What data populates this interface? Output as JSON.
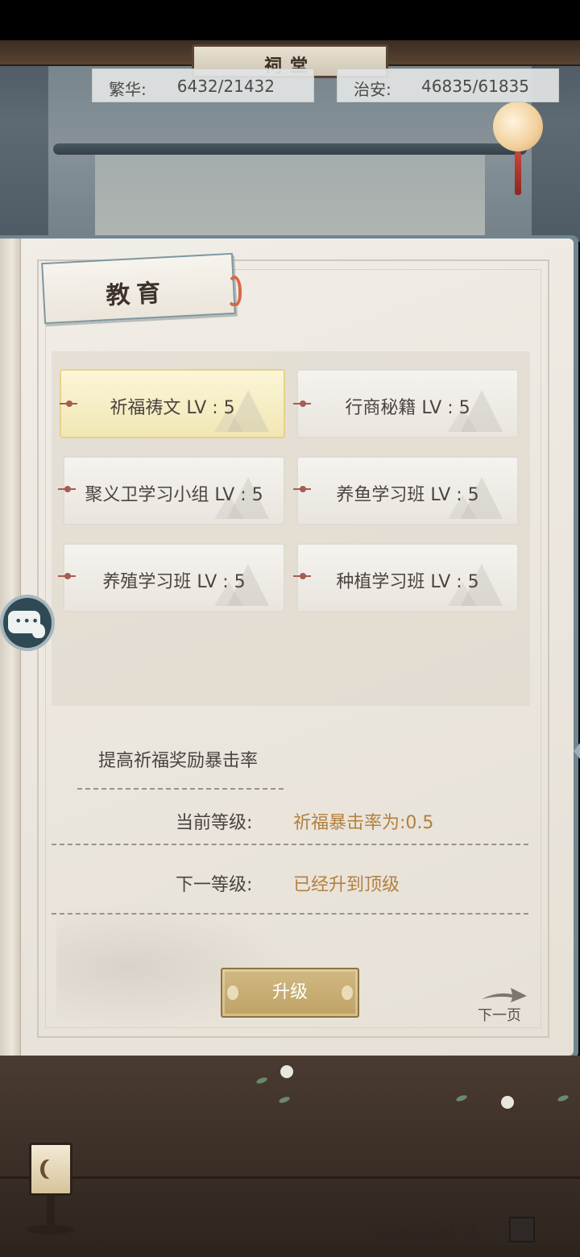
{
  "header": {
    "hall_name": "祠堂",
    "prosperity": {
      "label": "繁华:",
      "value": "6432/21432"
    },
    "security": {
      "label": "治安:",
      "value": "46835/61835"
    }
  },
  "tab": {
    "title": "教育"
  },
  "skills": [
    {
      "name": "祈福祷文 LV : 5",
      "selected": true
    },
    {
      "name": "行商秘籍 LV : 5",
      "selected": false
    },
    {
      "name": "聚义卫学习小组 LV : 5",
      "selected": false
    },
    {
      "name": "养鱼学习班 LV : 5",
      "selected": false
    },
    {
      "name": "养殖学习班 LV : 5",
      "selected": false
    },
    {
      "name": "种植学习班 LV : 5",
      "selected": false
    }
  ],
  "detail": {
    "description": "提高祈福奖励暴击率",
    "current_label": "当前等级:",
    "current_value": "祈福暴击率为:0.5",
    "next_label": "下一等级:",
    "next_value": "已经升到顶级"
  },
  "actions": {
    "upgrade_label": "升级",
    "next_page_label": "下一页"
  },
  "footer": {
    "auto_accept_label": "自动接受申请",
    "auto_accept_checked": false
  },
  "colors": {
    "accent_gold": "#b3803e",
    "button_gold": "#c9ad72",
    "selected_card": "#f4ebbd",
    "frame_blue": "#6f8590"
  }
}
